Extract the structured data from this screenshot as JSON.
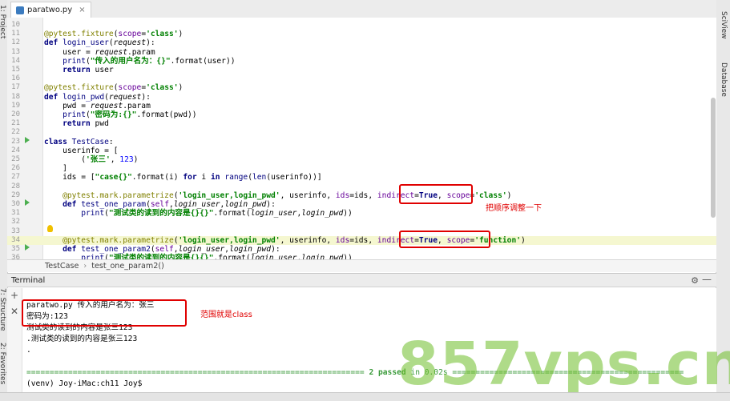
{
  "window": {
    "tab_title": "paratwo.py",
    "tab_close": "×"
  },
  "side_panels": {
    "left_top": "1: Project",
    "left_mid": "7: Structure",
    "left_bottom": "2: Favorites",
    "right_top": "SciView",
    "right_mid": "Database"
  },
  "editor": {
    "lines": [
      {
        "n": "10"
      },
      {
        "n": "11"
      },
      {
        "n": "12"
      },
      {
        "n": "13"
      },
      {
        "n": "14"
      },
      {
        "n": "15"
      },
      {
        "n": "16"
      },
      {
        "n": "17"
      },
      {
        "n": "18"
      },
      {
        "n": "19"
      },
      {
        "n": "20"
      },
      {
        "n": "21"
      },
      {
        "n": "22"
      },
      {
        "n": "23"
      },
      {
        "n": "24"
      },
      {
        "n": "25"
      },
      {
        "n": "26"
      },
      {
        "n": "27"
      },
      {
        "n": "28"
      },
      {
        "n": "29"
      },
      {
        "n": "30"
      },
      {
        "n": "31"
      },
      {
        "n": "32"
      },
      {
        "n": "33"
      },
      {
        "n": "34"
      },
      {
        "n": "35"
      },
      {
        "n": "36"
      }
    ]
  },
  "annotations": {
    "order_note": "把顺序调整一下",
    "scope_note": "范围就是class"
  },
  "breadcrumb": {
    "class_name": "TestCase",
    "sep": "›",
    "method_name": "test_one_param2()"
  },
  "terminal": {
    "title": "Terminal",
    "add_icon": "+",
    "close_icon": "✕",
    "lines": [
      "paratwo.py 传入的用户名为：张三",
      "密码为:123",
      "测试类的读到的内容是张三123",
      ".测试类的读到的内容是张三123",
      "."
    ],
    "summary_rule_left": "=========================================================================",
    "summary_text": "2 passed",
    "summary_time": " in 0.02s",
    "summary_rule_right": "==================================================",
    "prompt": "(venv) Joy-iMac:ch11 Joy$"
  },
  "watermark": "857vps.cn",
  "colors": {
    "annotation_red": "#e00000",
    "passed_green": "#3a9a3a",
    "watermark_green": "#6ebe28"
  }
}
